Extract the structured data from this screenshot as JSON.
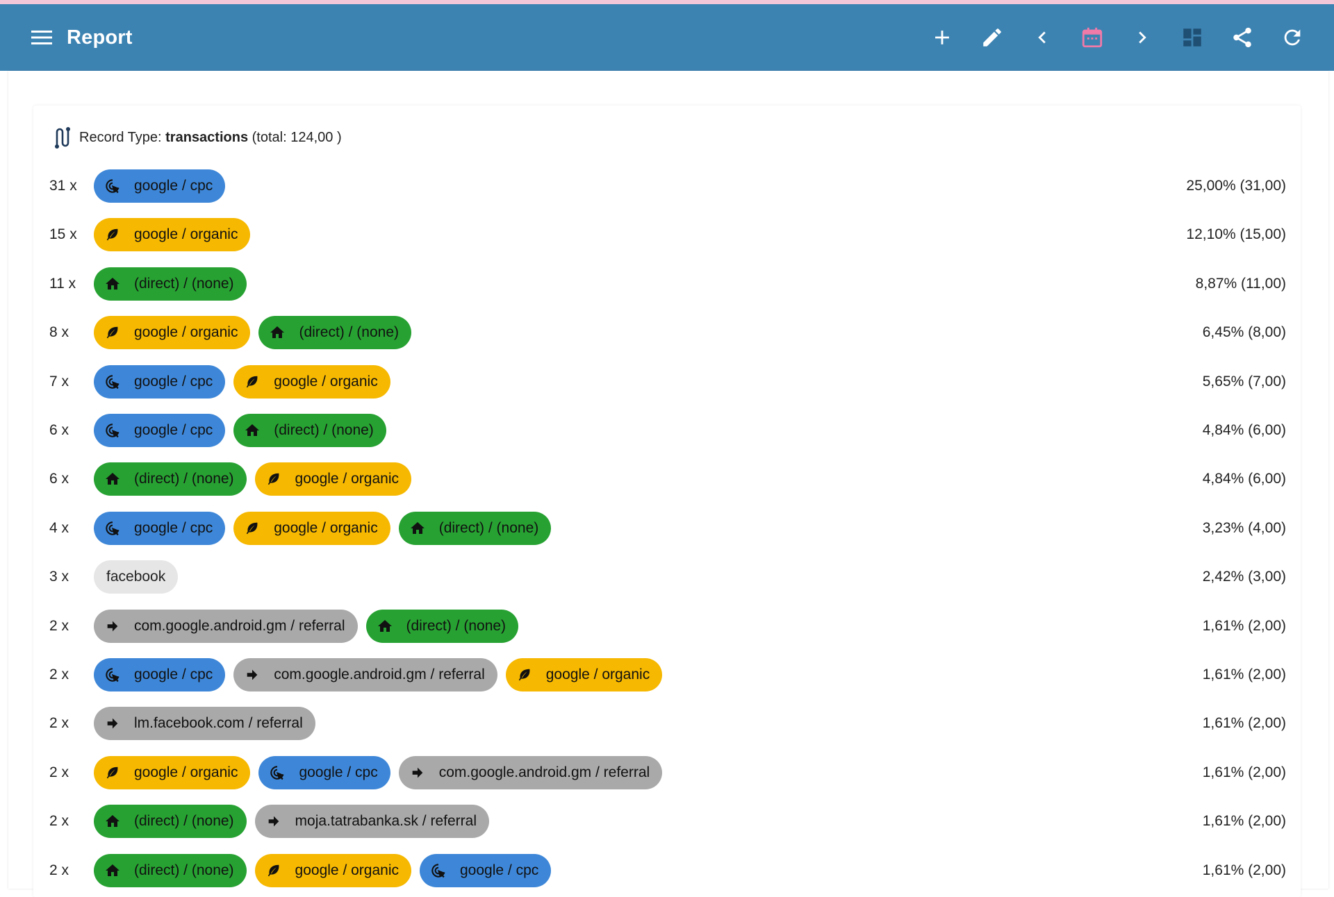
{
  "header": {
    "title": "Report",
    "icons": [
      "menu-icon",
      "plus-icon",
      "pencil-icon",
      "chevron-left-icon",
      "calendar-icon",
      "chevron-right-icon",
      "dashboard-icon",
      "share-icon",
      "refresh-icon"
    ],
    "calendar_color": "#f07aa8",
    "bar_color": "#3d83b2"
  },
  "record": {
    "prefix": "Record Type: ",
    "type": "transactions",
    "total": " (total: 124,00 )"
  },
  "channel_colors": {
    "cpc": "#3e87d8",
    "organic": "#f6b800",
    "direct": "#27a232",
    "referral": "#a9a9a9",
    "plain": "#e6e6e6"
  },
  "rows": [
    {
      "count": "31 x",
      "pct": "25,00% (31,00)",
      "chips": [
        {
          "label": "google / cpc",
          "kind": "cpc"
        }
      ]
    },
    {
      "count": "15 x",
      "pct": "12,10% (15,00)",
      "chips": [
        {
          "label": "google / organic",
          "kind": "organic"
        }
      ]
    },
    {
      "count": "11 x",
      "pct": "8,87% (11,00)",
      "chips": [
        {
          "label": "(direct) / (none)",
          "kind": "direct"
        }
      ]
    },
    {
      "count": "8 x",
      "pct": "6,45% (8,00)",
      "chips": [
        {
          "label": "google / organic",
          "kind": "organic"
        },
        {
          "label": "(direct) / (none)",
          "kind": "direct"
        }
      ]
    },
    {
      "count": "7 x",
      "pct": "5,65% (7,00)",
      "chips": [
        {
          "label": "google / cpc",
          "kind": "cpc"
        },
        {
          "label": "google / organic",
          "kind": "organic"
        }
      ]
    },
    {
      "count": "6 x",
      "pct": "4,84% (6,00)",
      "chips": [
        {
          "label": "google / cpc",
          "kind": "cpc"
        },
        {
          "label": "(direct) / (none)",
          "kind": "direct"
        }
      ]
    },
    {
      "count": "6 x",
      "pct": "4,84% (6,00)",
      "chips": [
        {
          "label": "(direct) / (none)",
          "kind": "direct"
        },
        {
          "label": "google / organic",
          "kind": "organic"
        }
      ]
    },
    {
      "count": "4 x",
      "pct": "3,23% (4,00)",
      "chips": [
        {
          "label": "google / cpc",
          "kind": "cpc"
        },
        {
          "label": "google / organic",
          "kind": "organic"
        },
        {
          "label": "(direct) / (none)",
          "kind": "direct"
        }
      ]
    },
    {
      "count": "3 x",
      "pct": "2,42% (3,00)",
      "chips": [
        {
          "label": "facebook",
          "kind": "plain"
        }
      ]
    },
    {
      "count": "2 x",
      "pct": "1,61% (2,00)",
      "chips": [
        {
          "label": "com.google.android.gm / referral",
          "kind": "referral"
        },
        {
          "label": "(direct) / (none)",
          "kind": "direct"
        }
      ]
    },
    {
      "count": "2 x",
      "pct": "1,61% (2,00)",
      "chips": [
        {
          "label": "google / cpc",
          "kind": "cpc"
        },
        {
          "label": "com.google.android.gm / referral",
          "kind": "referral"
        },
        {
          "label": "google / organic",
          "kind": "organic"
        }
      ]
    },
    {
      "count": "2 x",
      "pct": "1,61% (2,00)",
      "chips": [
        {
          "label": "lm.facebook.com / referral",
          "kind": "referral"
        }
      ]
    },
    {
      "count": "2 x",
      "pct": "1,61% (2,00)",
      "chips": [
        {
          "label": "google / organic",
          "kind": "organic"
        },
        {
          "label": "google / cpc",
          "kind": "cpc"
        },
        {
          "label": "com.google.android.gm / referral",
          "kind": "referral"
        }
      ]
    },
    {
      "count": "2 x",
      "pct": "1,61% (2,00)",
      "chips": [
        {
          "label": "(direct) / (none)",
          "kind": "direct"
        },
        {
          "label": "moja.tatrabanka.sk / referral",
          "kind": "referral"
        }
      ]
    },
    {
      "count": "2 x",
      "pct": "1,61% (2,00)",
      "chips": [
        {
          "label": "(direct) / (none)",
          "kind": "direct"
        },
        {
          "label": "google / organic",
          "kind": "organic"
        },
        {
          "label": "google / cpc",
          "kind": "cpc"
        }
      ]
    }
  ]
}
